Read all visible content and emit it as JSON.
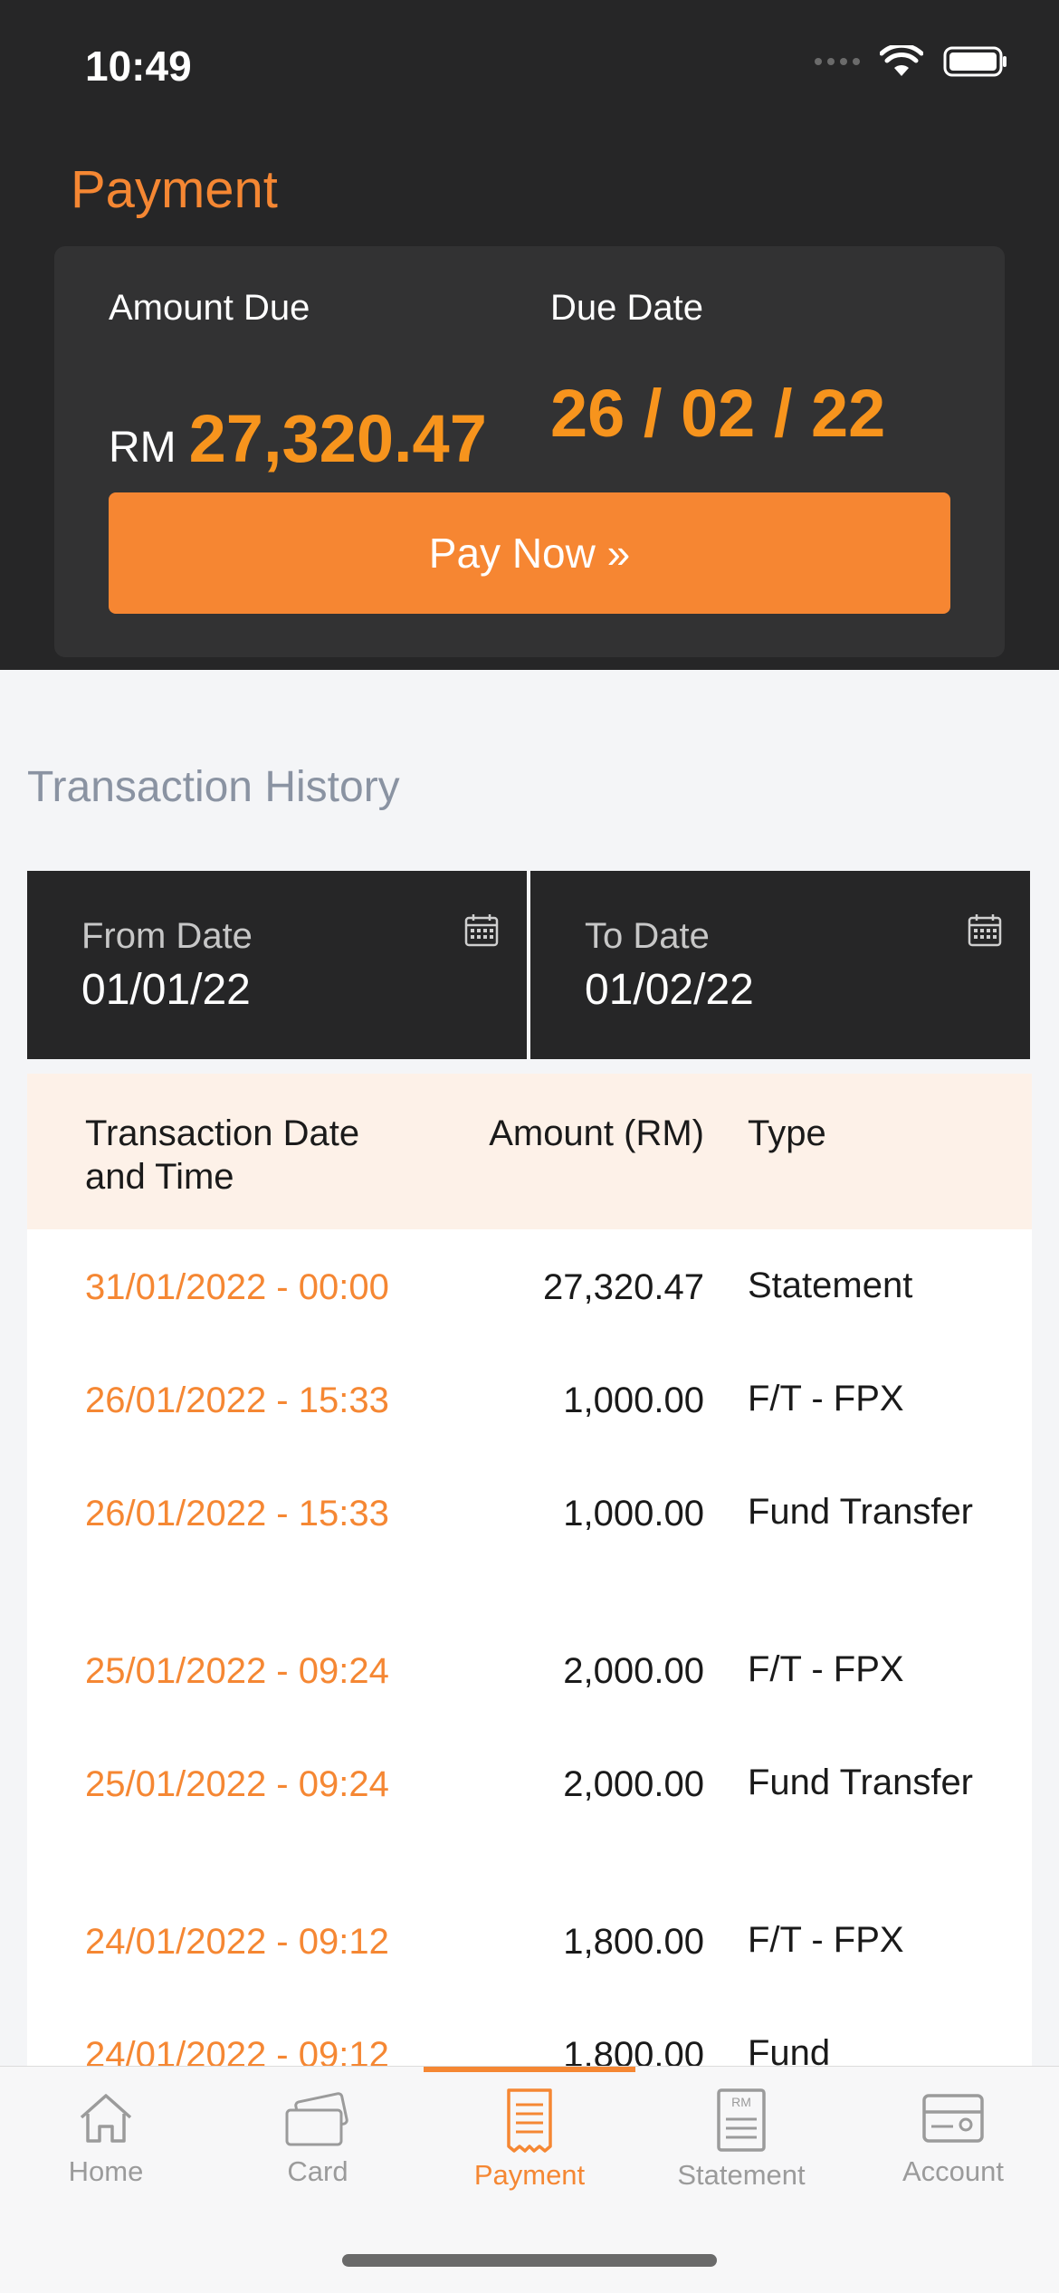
{
  "status_bar": {
    "time": "10:49"
  },
  "header": {
    "title": "Payment"
  },
  "summary": {
    "amount_due_label": "Amount Due",
    "currency": "RM",
    "amount_due": "27,320.47",
    "due_date_label": "Due Date",
    "due_date": "26 / 02 / 22",
    "pay_now_label": "Pay Now »"
  },
  "history": {
    "title": "Transaction History",
    "from_date_label": "From Date",
    "from_date_value": "01/01/22",
    "to_date_label": "To Date",
    "to_date_value": "01/02/22",
    "columns": {
      "date_line1": "Transaction Date",
      "date_line2": "and Time",
      "amount": "Amount (RM)",
      "type": "Type"
    },
    "rows": [
      {
        "date": "31/01/2022 - 00:00",
        "amount": "27,320.47",
        "type": "Statement"
      },
      {
        "date": "26/01/2022 - 15:33",
        "amount": "1,000.00",
        "type": "F/T - FPX"
      },
      {
        "date": "26/01/2022 - 15:33",
        "amount": "1,000.00",
        "type": "Fund Transfer"
      },
      {
        "date": "25/01/2022 - 09:24",
        "amount": "2,000.00",
        "type": "F/T - FPX"
      },
      {
        "date": "25/01/2022 - 09:24",
        "amount": "2,000.00",
        "type": "Fund Transfer"
      },
      {
        "date": "24/01/2022 - 09:12",
        "amount": "1,800.00",
        "type": "F/T - FPX"
      },
      {
        "date": "24/01/2022 - 09:12",
        "amount": "1,800.00",
        "type": "Fund"
      }
    ]
  },
  "tabs": [
    {
      "label": "Home",
      "icon": "home-icon"
    },
    {
      "label": "Card",
      "icon": "card-icon"
    },
    {
      "label": "Payment",
      "icon": "payment-receipt-icon",
      "active": true
    },
    {
      "label": "Statement",
      "icon": "statement-icon",
      "icon_text": "RM"
    },
    {
      "label": "Account",
      "icon": "account-icon"
    }
  ],
  "colors": {
    "accent": "#f58733",
    "dark": "#262627",
    "amount": "#f7941d"
  }
}
